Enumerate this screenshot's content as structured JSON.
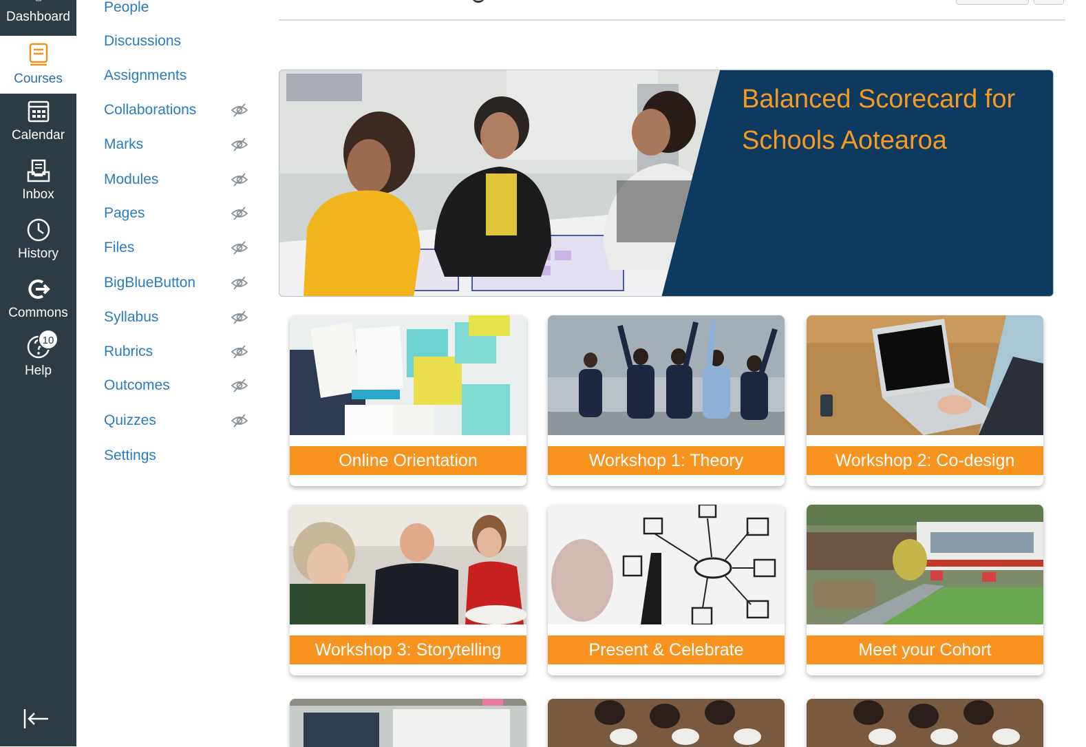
{
  "global_nav": {
    "items": [
      {
        "label": "Dashboard",
        "icon": "dashboard-icon"
      },
      {
        "label": "Courses",
        "icon": "courses-icon",
        "active": true
      },
      {
        "label": "Calendar",
        "icon": "calendar-icon"
      },
      {
        "label": "Inbox",
        "icon": "inbox-icon"
      },
      {
        "label": "History",
        "icon": "history-icon"
      },
      {
        "label": "Commons",
        "icon": "commons-icon"
      },
      {
        "label": "Help",
        "icon": "help-icon",
        "badge": "10"
      }
    ],
    "collapse_icon": "collapse-nav-icon"
  },
  "course_nav": {
    "items": [
      {
        "label": "People",
        "hidden": false
      },
      {
        "label": "Discussions",
        "hidden": false
      },
      {
        "label": "Assignments",
        "hidden": false
      },
      {
        "label": "Collaborations",
        "hidden": true
      },
      {
        "label": "Marks",
        "hidden": true
      },
      {
        "label": "Modules",
        "hidden": true
      },
      {
        "label": "Pages",
        "hidden": true
      },
      {
        "label": "Files",
        "hidden": true
      },
      {
        "label": "BigBlueButton",
        "hidden": true
      },
      {
        "label": "Syllabus",
        "hidden": true
      },
      {
        "label": "Rubrics",
        "hidden": true
      },
      {
        "label": "Outcomes",
        "hidden": true
      },
      {
        "label": "Quizzes",
        "hidden": true
      },
      {
        "label": "Settings",
        "hidden": false
      }
    ]
  },
  "banner": {
    "title": "Balanced Scorecard for Schools Aotearoa"
  },
  "cards": [
    {
      "label": "Online Orientation"
    },
    {
      "label": "Workshop 1: Theory"
    },
    {
      "label": "Workshop 2: Co-design"
    },
    {
      "label": "Workshop 3: Storytelling"
    },
    {
      "label": "Present & Celebrate"
    },
    {
      "label": "Meet your Cohort"
    }
  ],
  "colors": {
    "nav_bg": "#2d3b45",
    "link": "#2b7bbf",
    "accent_orange": "#f7931e",
    "banner_navy": "#0e3a5f"
  }
}
